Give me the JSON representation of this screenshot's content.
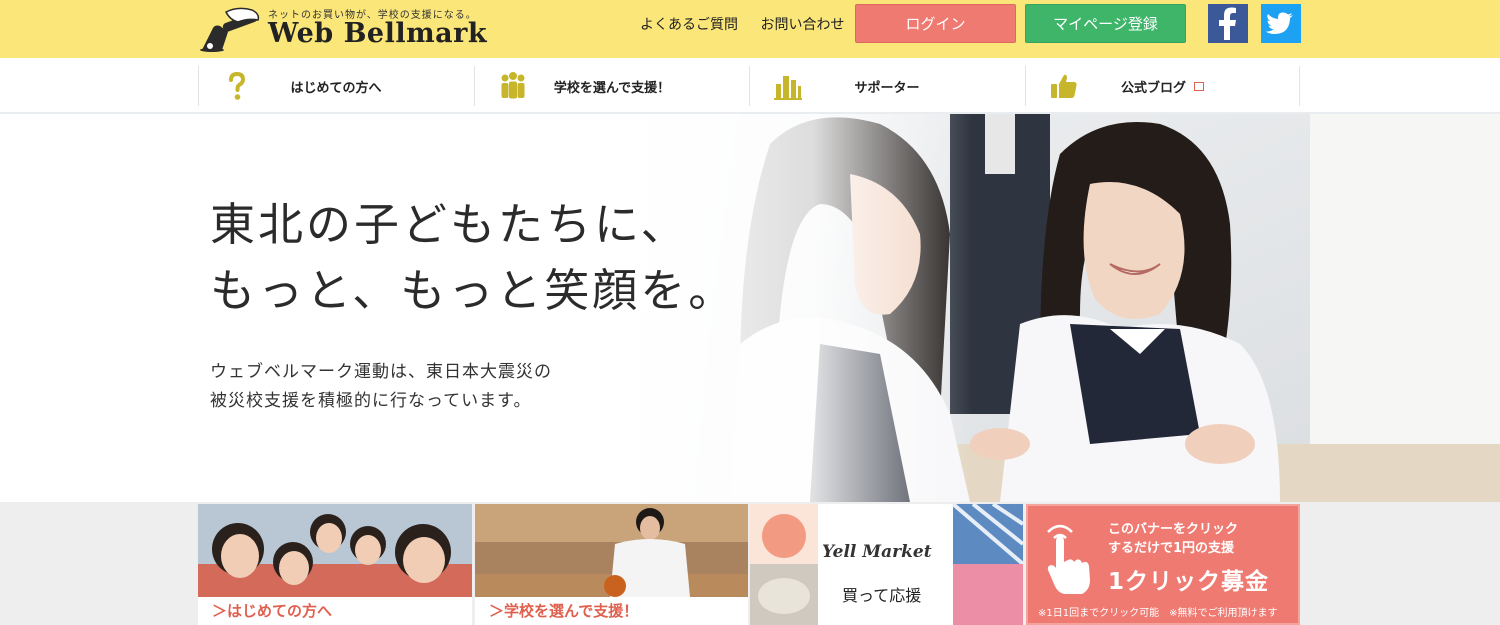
{
  "colors": {
    "topbar_bg": "#fbe679",
    "login_bg": "#ef7a72",
    "register_bg": "#3fb56a",
    "facebook": "#3b5998",
    "twitter": "#1da1f2",
    "accent_red": "#e0604f",
    "nav_icon": "#c7b62b"
  },
  "header": {
    "logo": {
      "tagline": "ネットのお買い物が、学校の支援になる。",
      "wordmark": "Web Bellmark",
      "icon": "bell-icon"
    },
    "links": [
      "よくあるご質問",
      "お問い合わせ"
    ],
    "login_label": "ログイン",
    "register_label": "マイページ登録",
    "sns": [
      "facebook-icon",
      "twitter-icon"
    ]
  },
  "nav": {
    "items": [
      {
        "label": "はじめての方へ",
        "icon": "question-mark-icon"
      },
      {
        "label": "学校を選んで支援！",
        "icon": "people-group-icon"
      },
      {
        "label": "サポーター",
        "icon": "buildings-icon"
      },
      {
        "label": "公式ブログ",
        "icon": "thumbs-up-icon",
        "external": true
      }
    ]
  },
  "hero": {
    "title": "東北の子どもたちに、\nもっと、もっと笑顔を。",
    "subtitle": "ウェブベルマーク運動は、東日本大震災の\n被災校支援を積極的に行なっています。"
  },
  "banners": {
    "b1_caption": "＞はじめての方へ",
    "b2_caption": "＞学校を選んで支援！",
    "b3_logo": "Yell Market",
    "b3_caption": "買って応援",
    "b4_line1": "このバナーをクリック",
    "b4_line2": "するだけで1円の支援",
    "b4_big": "1クリック募金",
    "b4_notes": "※1日1回までクリック可能　※無料でご利用頂けます"
  }
}
